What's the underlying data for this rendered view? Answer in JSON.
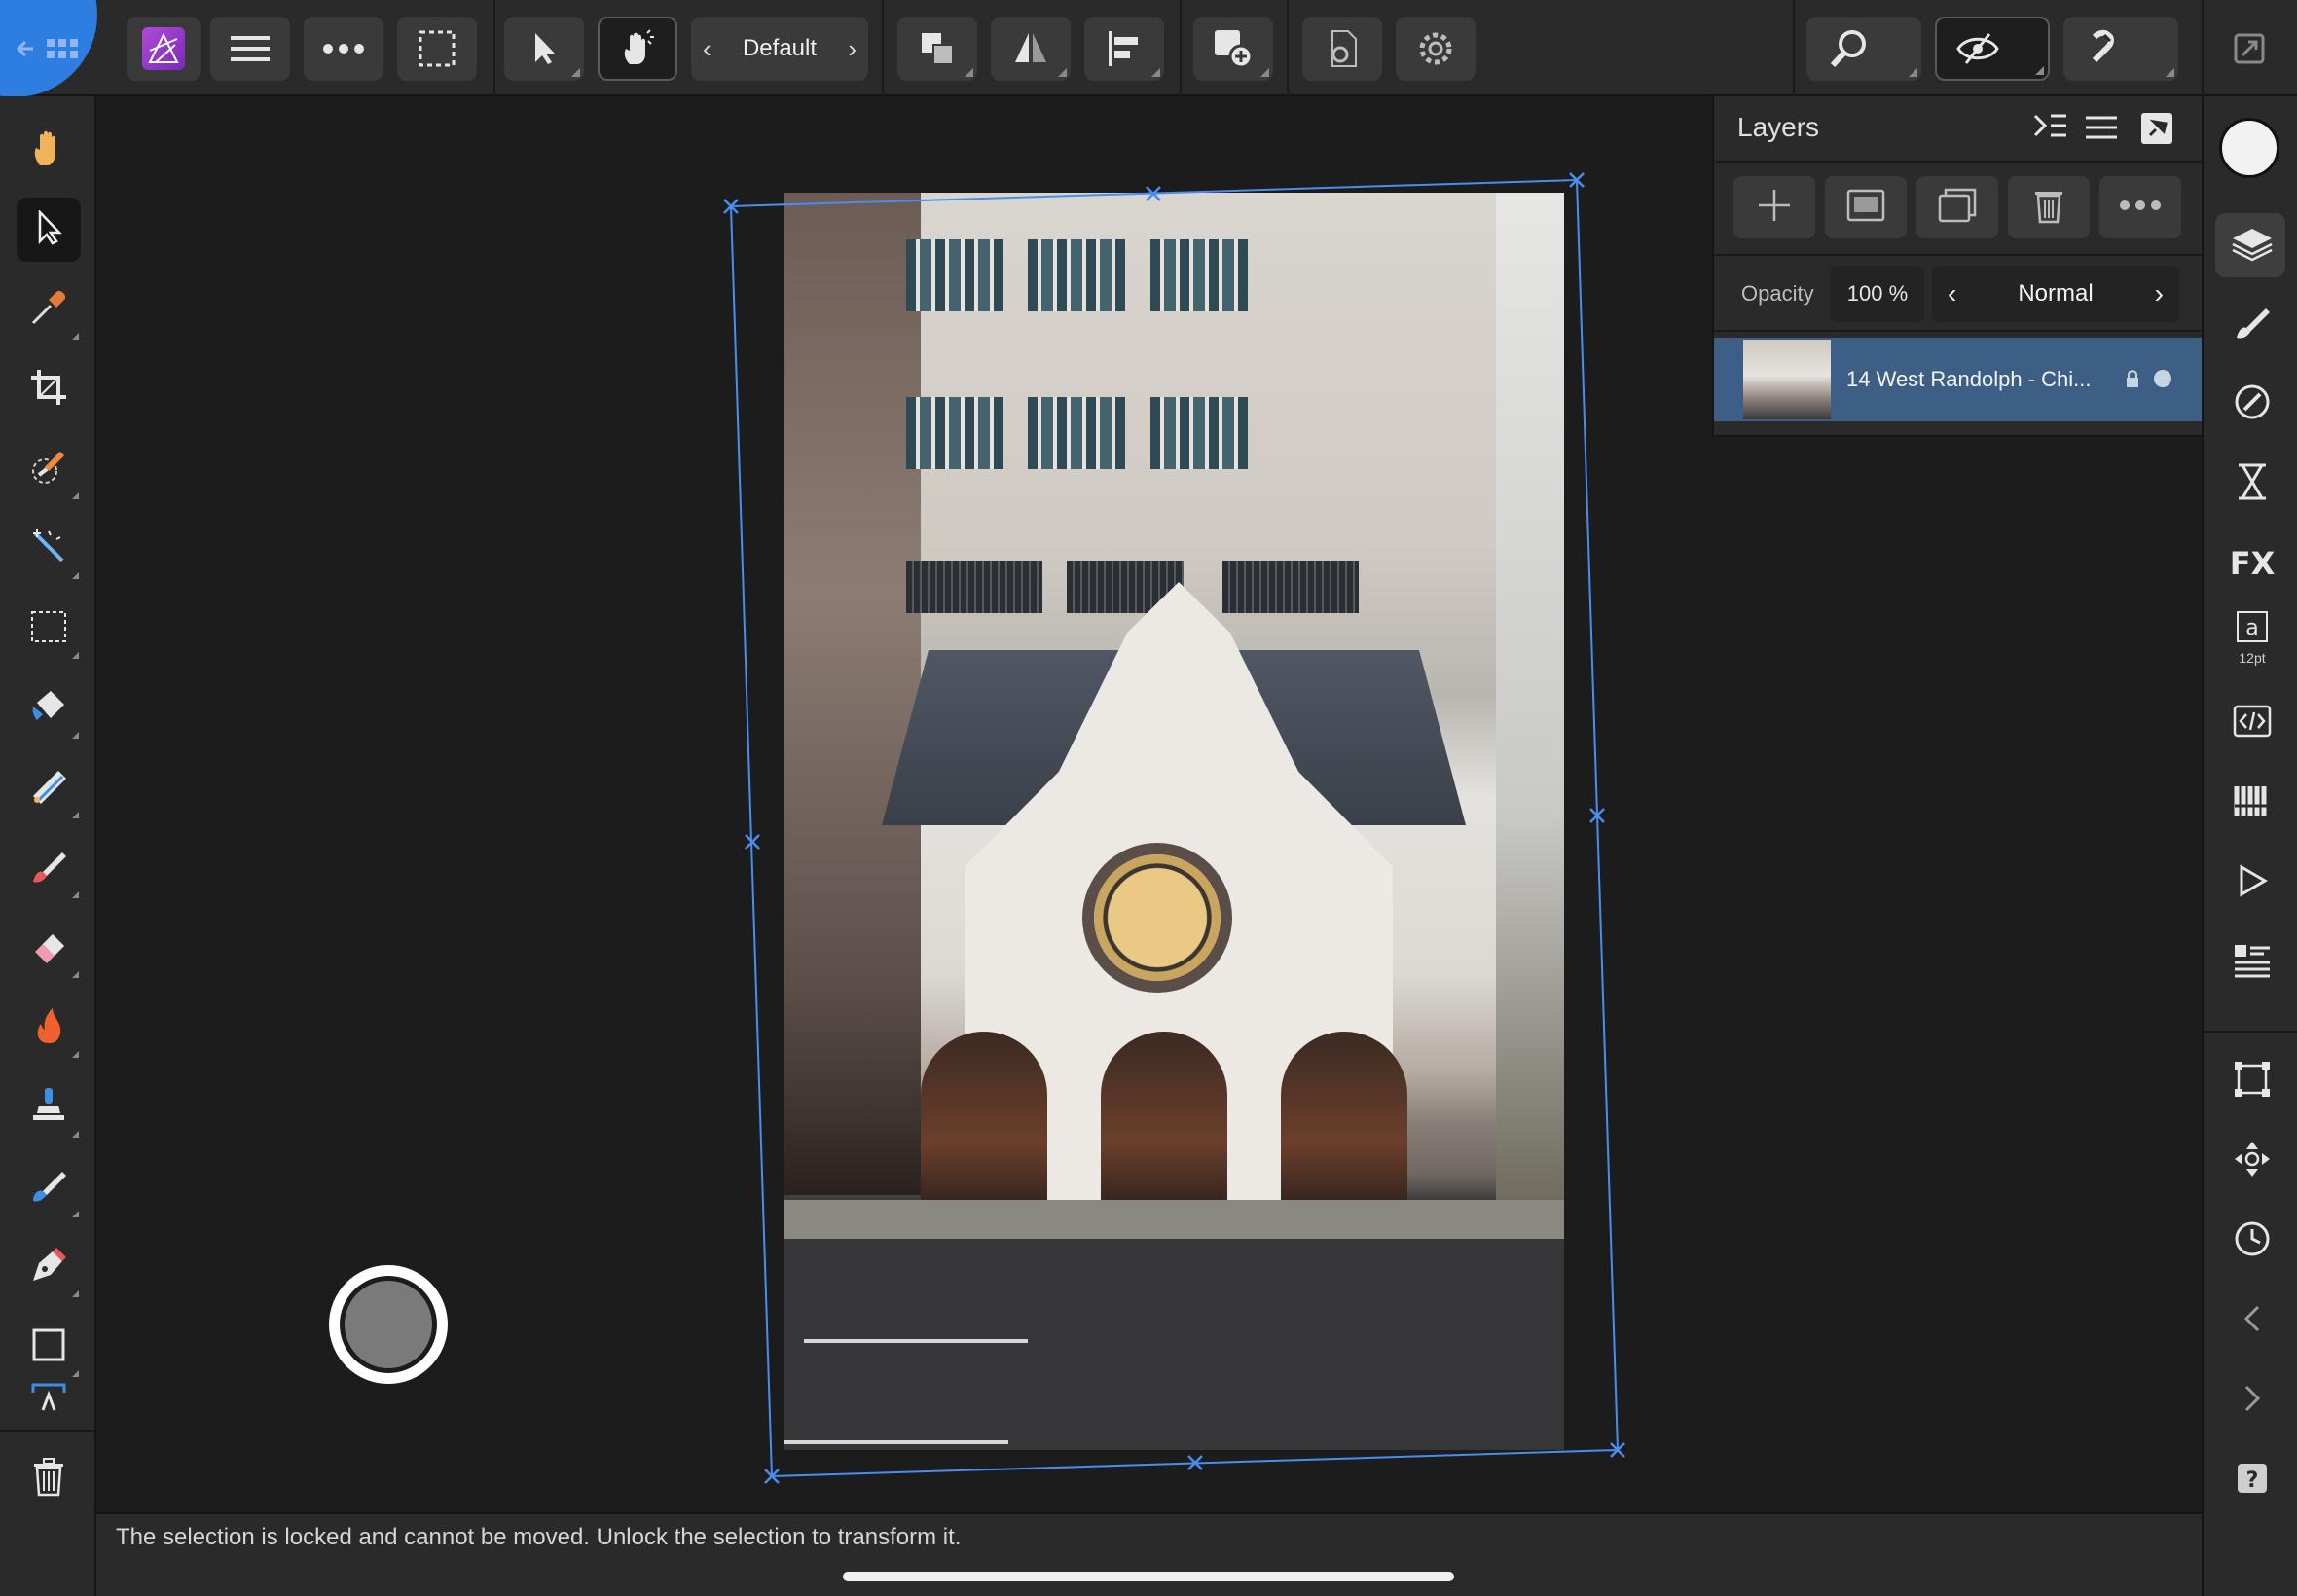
{
  "toolbar": {
    "preset_label": "Default",
    "buttons": [
      "home",
      "persona-photo",
      "menu",
      "more",
      "selection-mode",
      "move-tool",
      "gesture",
      "arrange",
      "flip",
      "align",
      "insert",
      "document-setup",
      "settings",
      "zoom",
      "view",
      "snapping",
      "fullscreen"
    ]
  },
  "tools": [
    "hand",
    "move",
    "color-picker",
    "crop",
    "selection-brush",
    "flood-select",
    "rectangular-marquee",
    "flood-fill",
    "gradient",
    "paint-brush",
    "erase",
    "dodge",
    "clone",
    "smudge",
    "pen",
    "rectangle",
    "text",
    "delete"
  ],
  "layers": {
    "title": "Layers",
    "opacity_label": "Opacity",
    "opacity_value": "100 %",
    "blend_mode": "Normal",
    "items": [
      {
        "name": "14 West Randolph - Chi..."
      }
    ]
  },
  "right_studio": {
    "text_size": "12pt"
  },
  "status": {
    "message": "The selection is locked and cannot be moved. Unlock the selection to transform it."
  },
  "colors": {
    "accent": "#2e7de0",
    "selection": "#4a8cf0",
    "layer_selected": "#3e5f85",
    "panel_bg": "#2a2a2a"
  }
}
